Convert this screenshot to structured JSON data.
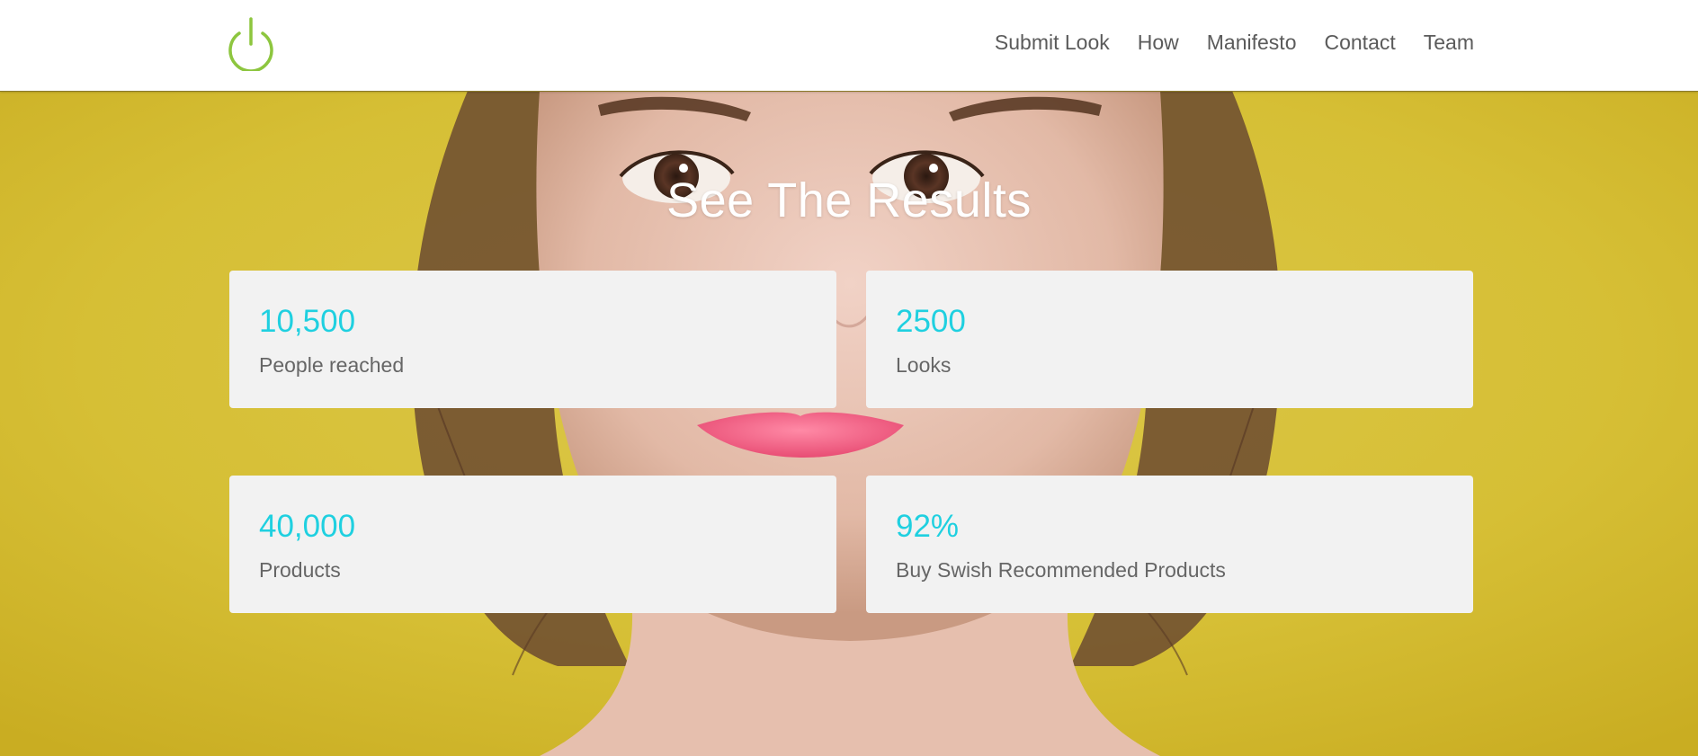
{
  "header": {
    "logo_icon": "power-icon",
    "logo_color": "#8dc63f",
    "nav": [
      {
        "label": "Submit Look"
      },
      {
        "label": "How"
      },
      {
        "label": "Manifesto"
      },
      {
        "label": "Contact"
      },
      {
        "label": "Team"
      }
    ]
  },
  "hero": {
    "title": "See The Results",
    "background_color": "#d4bb2e",
    "image_description_icon": "portrait-photo"
  },
  "stats": [
    {
      "value": "10,500",
      "label": "People reached"
    },
    {
      "value": "2500",
      "label": "Looks"
    },
    {
      "value": "40,000",
      "label": "Products"
    },
    {
      "value": "92%",
      "label": "Buy Swish Recommended Products"
    }
  ],
  "colors": {
    "accent": "#1fd0e0",
    "card_bg": "#f2f2f2",
    "label_text": "#666666",
    "nav_text": "#5b5b5b"
  }
}
